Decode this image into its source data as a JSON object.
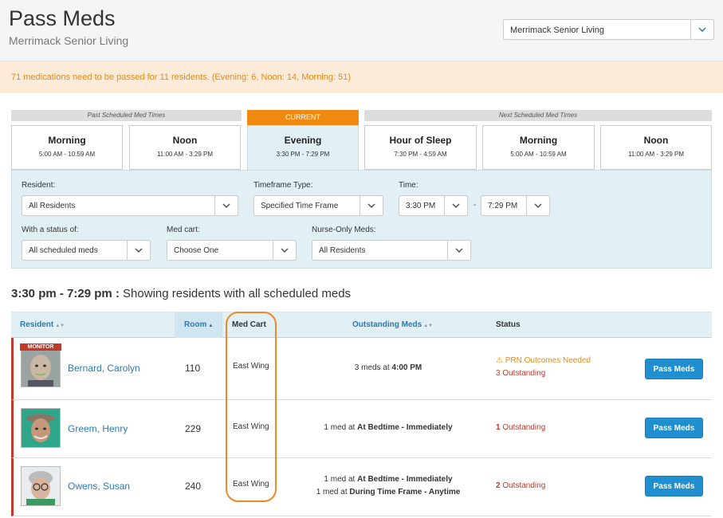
{
  "header": {
    "title": "Pass Meds",
    "subtitle": "Merrimack Senior Living",
    "facility_select": "Merrimack Senior Living"
  },
  "alert": "71 medications need to be passed for 11 residents. (Evening: 6, Noon: 14, Morning: 51)",
  "tabs": {
    "past_label": "Past Scheduled Med Times",
    "current_label": "CURRENT",
    "next_label": "Next Scheduled Med Times",
    "slots": [
      {
        "name": "Morning",
        "time": "5:00 AM - 10:59 AM"
      },
      {
        "name": "Noon",
        "time": "11:00 AM - 3:29 PM"
      },
      {
        "name": "Evening",
        "time": "3:30 PM - 7:29 PM"
      },
      {
        "name": "Hour of Sleep",
        "time": "7:30 PM - 4:59 AM"
      },
      {
        "name": "Morning",
        "time": "5:00 AM - 10:59 AM"
      },
      {
        "name": "Noon",
        "time": "11:00 AM - 3:29 PM"
      }
    ]
  },
  "filters": {
    "resident_label": "Resident:",
    "resident_value": "All Residents",
    "timeframe_label": "Timeframe Type:",
    "timeframe_value": "Specified Time Frame",
    "time_label": "Time:",
    "time_from": "3:30 PM",
    "time_sep": "-",
    "time_to": "7:29 PM",
    "status_label": "With a status of:",
    "status_value": "All scheduled meds",
    "cart_label": "Med cart:",
    "cart_value": "Choose One",
    "nurse_label": "Nurse-Only Meds:",
    "nurse_value": "All Residents"
  },
  "section": {
    "range": "3:30 pm - 7:29 pm :",
    "description": "Showing residents with all scheduled meds"
  },
  "table": {
    "headers": {
      "resident": "Resident",
      "room": "Room",
      "cart": "Med Cart",
      "meds": "Outstanding Meds",
      "status": "Status"
    },
    "monitor_tag": "MONITOR",
    "pass_label": "Pass Meds",
    "rows": [
      {
        "name": "Bernard, Carolyn",
        "room": "110",
        "cart": "East Wing",
        "meds": [
          {
            "pre": "3 meds at ",
            "bold": "4:00 PM"
          }
        ],
        "warning": "PRN Outcomes Needed",
        "outstanding_count": "3",
        "outstanding_text": " Outstanding"
      },
      {
        "name": "Greem, Henry",
        "room": "229",
        "cart": "East Wing",
        "meds": [
          {
            "pre": "1 med at ",
            "bold": "At Bedtime - Immediately"
          }
        ],
        "warning": "",
        "outstanding_count": "1",
        "outstanding_text": " Outstanding"
      },
      {
        "name": "Owens, Susan",
        "room": "240",
        "cart": "East Wing",
        "meds": [
          {
            "pre": "1 med at ",
            "bold": "At Bedtime - Immediately"
          },
          {
            "pre": "1 med at ",
            "bold": "During Time Frame - Anytime"
          }
        ],
        "warning": "",
        "outstanding_count": "2",
        "outstanding_text": " Outstanding"
      }
    ]
  },
  "colors": {
    "accent": "#1f8fd0",
    "current_tab": "#f0890f",
    "alert_text": "#e38a1a",
    "danger": "#c0392b",
    "panel_bg": "#e0f0f4"
  }
}
